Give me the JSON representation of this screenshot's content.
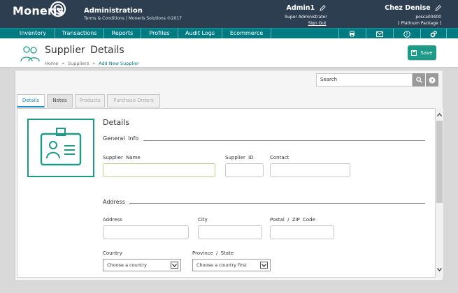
{
  "header": {
    "logo_text": "Moneris",
    "app_title": "Administration",
    "app_subtitle": "Terms & Conditions | Moneris Solutions ©2017",
    "user_name": "Admin1",
    "user_role": "Super Administrator",
    "sign_out": "Sign Out",
    "store_name": "Chez Denise",
    "store_id": "posca00400",
    "store_package": "[ Platinum Package ]"
  },
  "nav": {
    "items": [
      "Inventory",
      "Transactions",
      "Reports",
      "Profiles",
      "Audit Logs",
      "Ecommerce"
    ],
    "icons": [
      "printer-icon",
      "mail-icon",
      "help-icon",
      "settings-icon"
    ]
  },
  "page": {
    "title": "Supplier Details",
    "breadcrumb": [
      "Home",
      "Suppliers",
      "Add New Supplier"
    ],
    "save_label": "Save"
  },
  "toolbar": {
    "search_value": "Search"
  },
  "tabs": [
    "Details",
    "Notes",
    "Products",
    "Purchase Orders"
  ],
  "form": {
    "section_title": "Details",
    "general_info": "General Info",
    "supplier_name_label": "Supplier Name",
    "supplier_id_label": "Supplier ID",
    "contact_label": "Contact",
    "address_group": "Address",
    "address_label": "Address",
    "city_label": "City",
    "postal_label": "Postal / ZIP Code",
    "country_label": "Country",
    "province_label": "Province / State",
    "country_value": "Choose a country",
    "province_value": "Choose a country first"
  },
  "colors": {
    "header_bg": "#2c3e50",
    "nav_bg": "#007b82",
    "accent": "#1e9a88",
    "tab_active": "#1b8bc4"
  }
}
